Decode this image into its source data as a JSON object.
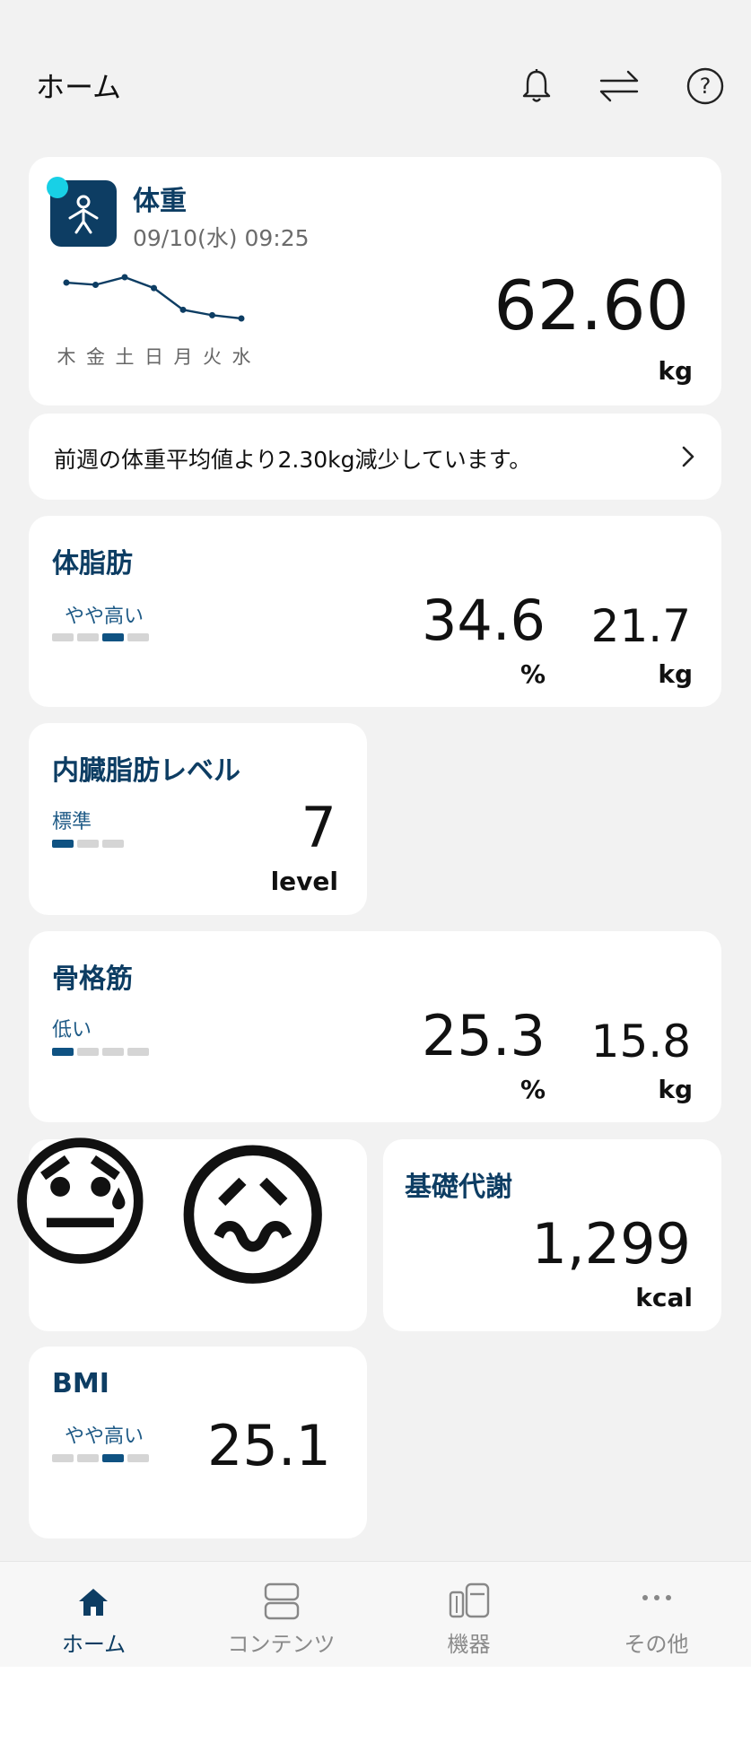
{
  "header": {
    "title": "ホーム"
  },
  "weight_card": {
    "title": "体重",
    "datetime": "09/10(水) 09:25",
    "value": "62.60",
    "unit": "kg",
    "days": [
      "木",
      "金",
      "土",
      "日",
      "月",
      "火",
      "水"
    ],
    "trend": [
      62.9,
      62.88,
      62.95,
      62.85,
      62.65,
      62.6,
      62.57
    ]
  },
  "message": {
    "text": "前週の体重平均値より2.30kg減少しています。"
  },
  "body_fat": {
    "title": "体脂肪",
    "level": "やや高い",
    "level_index": 3,
    "level_total": 4,
    "percent": "34.6",
    "percent_unit": "%",
    "mass": "21.7",
    "mass_unit": "kg"
  },
  "visceral_fat": {
    "title": "内臓脂肪レベル",
    "level": "標準",
    "level_index": 1,
    "level_total": 3,
    "value": "7",
    "unit": "level"
  },
  "skeletal_muscle": {
    "title": "骨格筋",
    "level": "低い",
    "level_index": 1,
    "level_total": 4,
    "percent": "25.3",
    "percent_unit": "%",
    "mass": "15.8",
    "mass_unit": "kg"
  },
  "emoji_card": {
    "emoji1": "😓",
    "emoji2": "😖"
  },
  "bmr": {
    "title": "基礎代謝",
    "value": "1,299",
    "unit": "kcal"
  },
  "bmi": {
    "title": "BMI",
    "level": "やや高い",
    "level_index": 3,
    "level_total": 4,
    "value": "25.1"
  },
  "nav": {
    "home": "ホーム",
    "contents": "コンテンツ",
    "devices": "機器",
    "other": "その他"
  },
  "colors": {
    "accent": "#0d3d63",
    "bar_on": "#0f5282",
    "bar_off": "#d5d5d5",
    "badge": "#18d0e6"
  }
}
